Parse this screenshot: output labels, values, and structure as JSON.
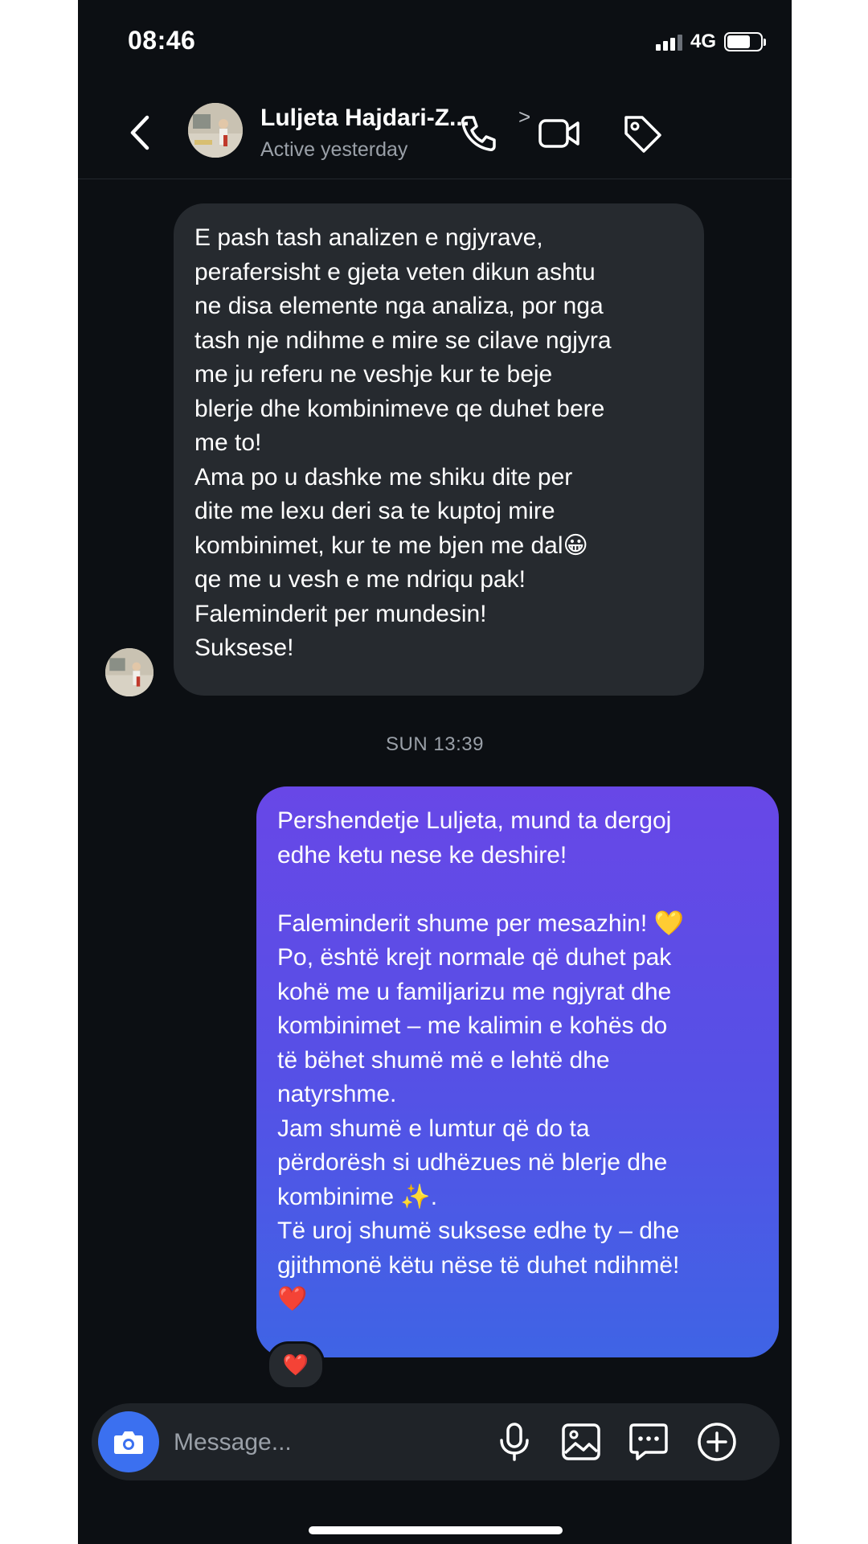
{
  "status_bar": {
    "time": "08:46",
    "network": "4G",
    "battery_level": 0.7
  },
  "header": {
    "contact_name": "Luljeta Hajdari-Z...",
    "status": "Active yesterday",
    "icons": [
      "back-icon",
      "phone-icon",
      "video-icon",
      "tag-icon"
    ]
  },
  "messages": {
    "incoming": {
      "text": "E pash tash analizen e ngjyrave,\nperafersisht e gjeta veten dikun ashtu\nne disa elemente nga analiza, por nga\ntash nje ndihme e mire se cilave ngjyra\nme ju referu ne veshje kur te beje\nblerje dhe kombinimeve qe duhet bere\nme to!\nAma po u dashke me shiku dite per\ndite me lexu deri sa te kuptoj mire\nkombinimet, kur te me bjen me dal😀\nqe me u vesh e me ndriqu pak!\nFaleminderit per mundesin!\nSuksese!"
    },
    "timestamp": "SUN 13:39",
    "outgoing": {
      "text": "Pershendetje Luljeta, mund ta dergoj\nedhe ketu nese ke deshire!\n\nFaleminderit shume per mesazhin! 💛\nPo, është krejt normale që duhet pak\nkohë me u familjarizu me ngjyrat dhe\nkombinimet – me kalimin e kohës do\ntë bëhet shumë më e lehtë dhe\nnatyrshme.\nJam shumë e lumtur që do ta\npërdorësh si udhëzues në blerje dhe\nkombinime ✨.\nTë uroj shumë suksese edhe ty – dhe\ngjithmonë këtu nëse të duhet ndihmë!\n❤️",
      "reaction": "❤️"
    }
  },
  "composer": {
    "placeholder": "Message...",
    "icons": [
      "camera-icon",
      "microphone-icon",
      "gallery-icon",
      "sticker-icon",
      "plus-icon"
    ]
  },
  "colors": {
    "background": "#0c0f13",
    "incoming_bubble": "#262a2f",
    "outgoing_gradient_top": "#6847e7",
    "outgoing_gradient_bottom": "#3f64e5",
    "camera_button": "#3b70f0"
  }
}
